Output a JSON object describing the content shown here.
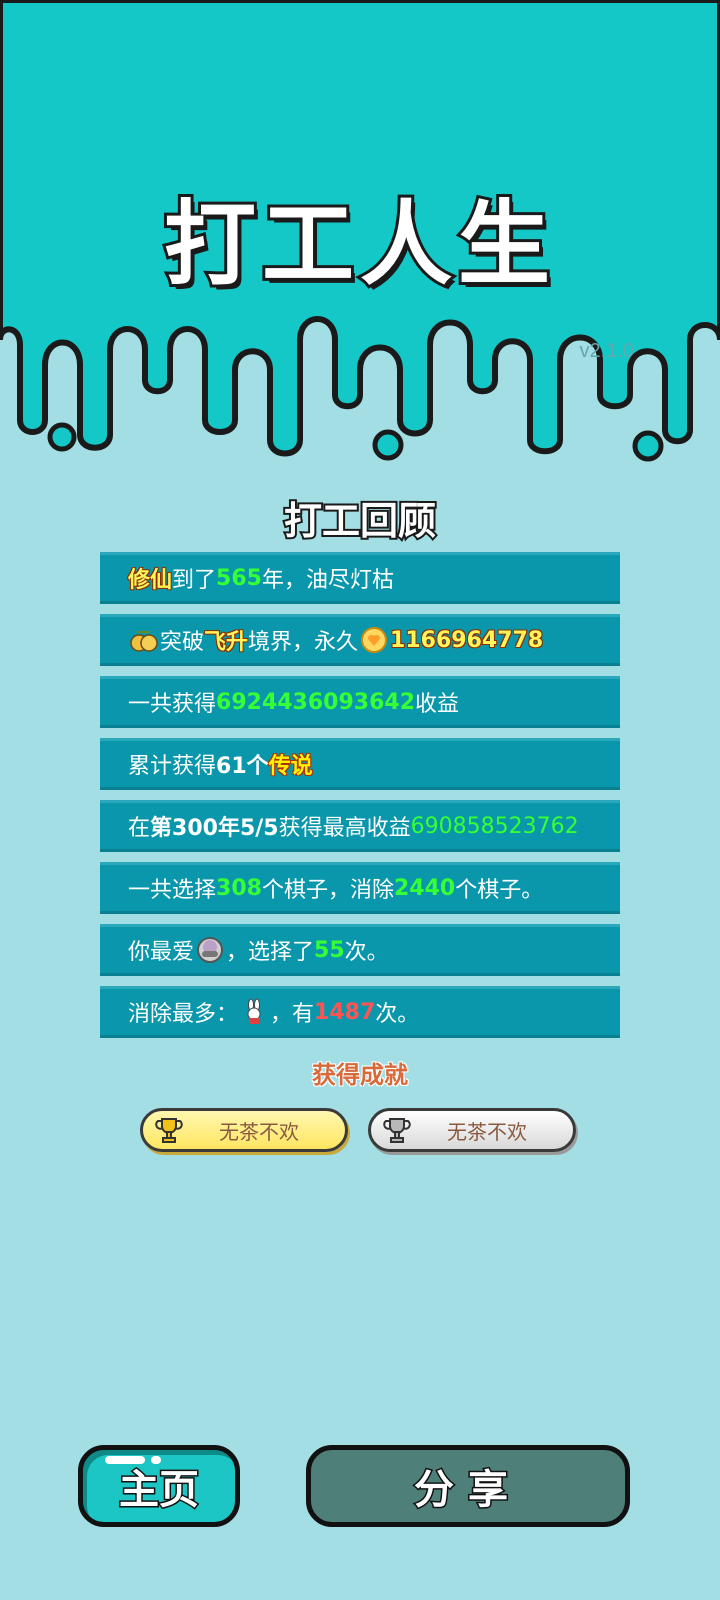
{
  "app": {
    "title": "打工人生",
    "version": "v2.1.0"
  },
  "review": {
    "title": "打工回顾",
    "rows": [
      {
        "parts": [
          "修仙",
          "到了",
          "565",
          "年，油尽灯枯"
        ]
      },
      {
        "parts": [
          "突破",
          "飞升",
          "境界，永久",
          "1166964778"
        ]
      },
      {
        "parts": [
          "一共获得",
          "6924436093642",
          "收益"
        ]
      },
      {
        "parts": [
          "累计获得",
          "61个",
          "传说"
        ]
      },
      {
        "parts": [
          "在 ",
          "第300年5/5",
          " 获得最高收益",
          "690858523762"
        ]
      },
      {
        "parts": [
          "一共选择",
          "308",
          "个棋子，消除",
          "2440",
          "个棋子。"
        ]
      },
      {
        "parts": [
          "你最爱",
          "，选择了",
          "55",
          "次。"
        ]
      },
      {
        "parts": [
          "消除最多：",
          "，有",
          "1487",
          "次。"
        ]
      }
    ],
    "icons": {
      "row2": "pear-fruit-icon",
      "row2b": "heart-coin-icon",
      "row7": "rice-bowl-icon",
      "row8": "rabbit-icon"
    }
  },
  "achievements": {
    "title": "获得成就",
    "badges": [
      {
        "label": "无茶不欢",
        "tier": "gold",
        "icon": "trophy-icon"
      },
      {
        "label": "无茶不欢",
        "tier": "silver",
        "icon": "trophy-icon"
      }
    ]
  },
  "buttons": {
    "home": "主页",
    "share": "分享"
  },
  "colors": {
    "accent": "#14c8c8",
    "background": "#a3dee5",
    "row": "#0b97ab",
    "highlight_green": "#35ff35",
    "highlight_red": "#ff5454"
  }
}
